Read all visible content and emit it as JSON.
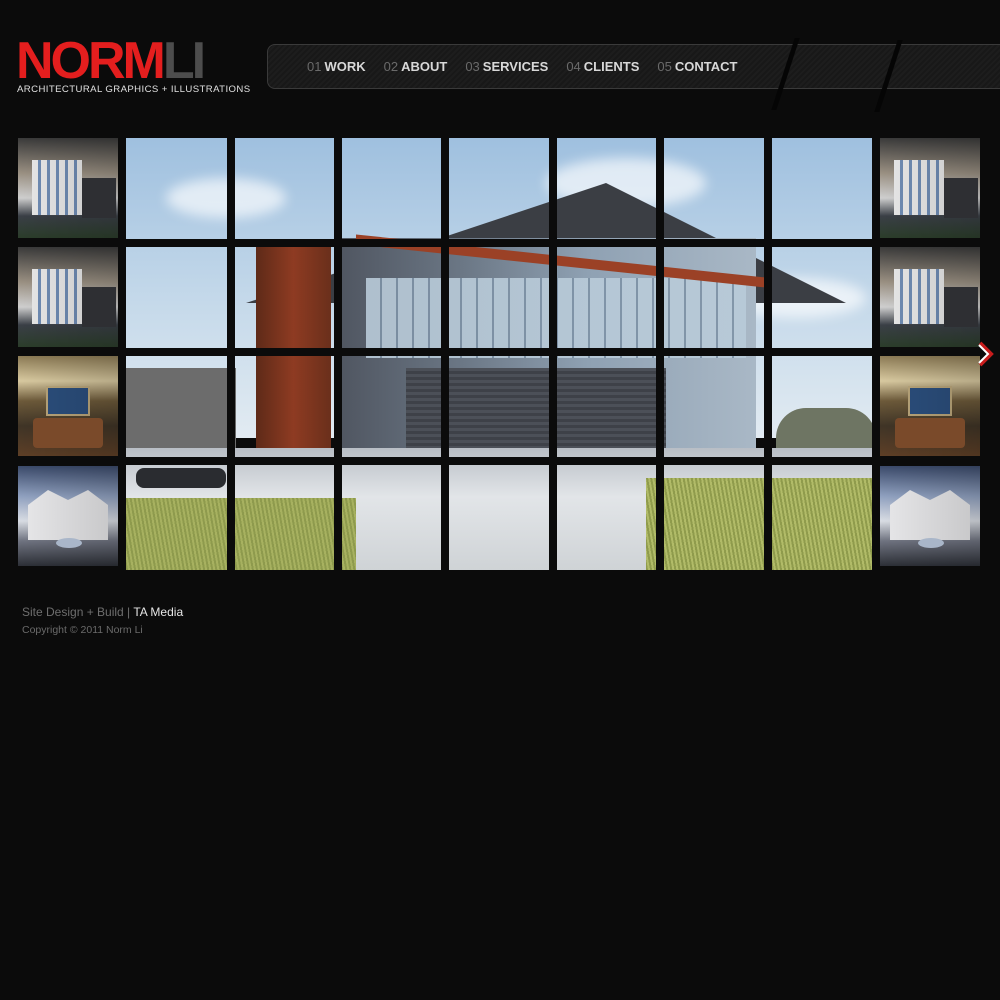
{
  "brand": {
    "logo_norm": "NORM",
    "logo_li": "LI",
    "tagline": "ARCHITECTURAL GRAPHICS + ILLUSTRATIONS",
    "colors": {
      "red": "#e41e1e",
      "gray": "#4d4d4d"
    }
  },
  "nav": {
    "items": [
      {
        "num": "01",
        "label": "WORK"
      },
      {
        "num": "02",
        "label": "ABOUT"
      },
      {
        "num": "03",
        "label": "SERVICES"
      },
      {
        "num": "04",
        "label": "CLIENTS"
      },
      {
        "num": "05",
        "label": "CONTACT"
      }
    ]
  },
  "gallery": {
    "left_thumbs": [
      "modern-building",
      "modern-building",
      "dining-room",
      "house"
    ],
    "right_thumbs": [
      "modern-building",
      "modern-building",
      "dining-room",
      "house"
    ],
    "featured": "modern-office-building",
    "next_icon": "chevron-right-icon"
  },
  "footer": {
    "credit_prefix": "Site Design + Build |",
    "credit_link": "TA Media",
    "copyright": "Copyright © 2011 Norm Li"
  }
}
